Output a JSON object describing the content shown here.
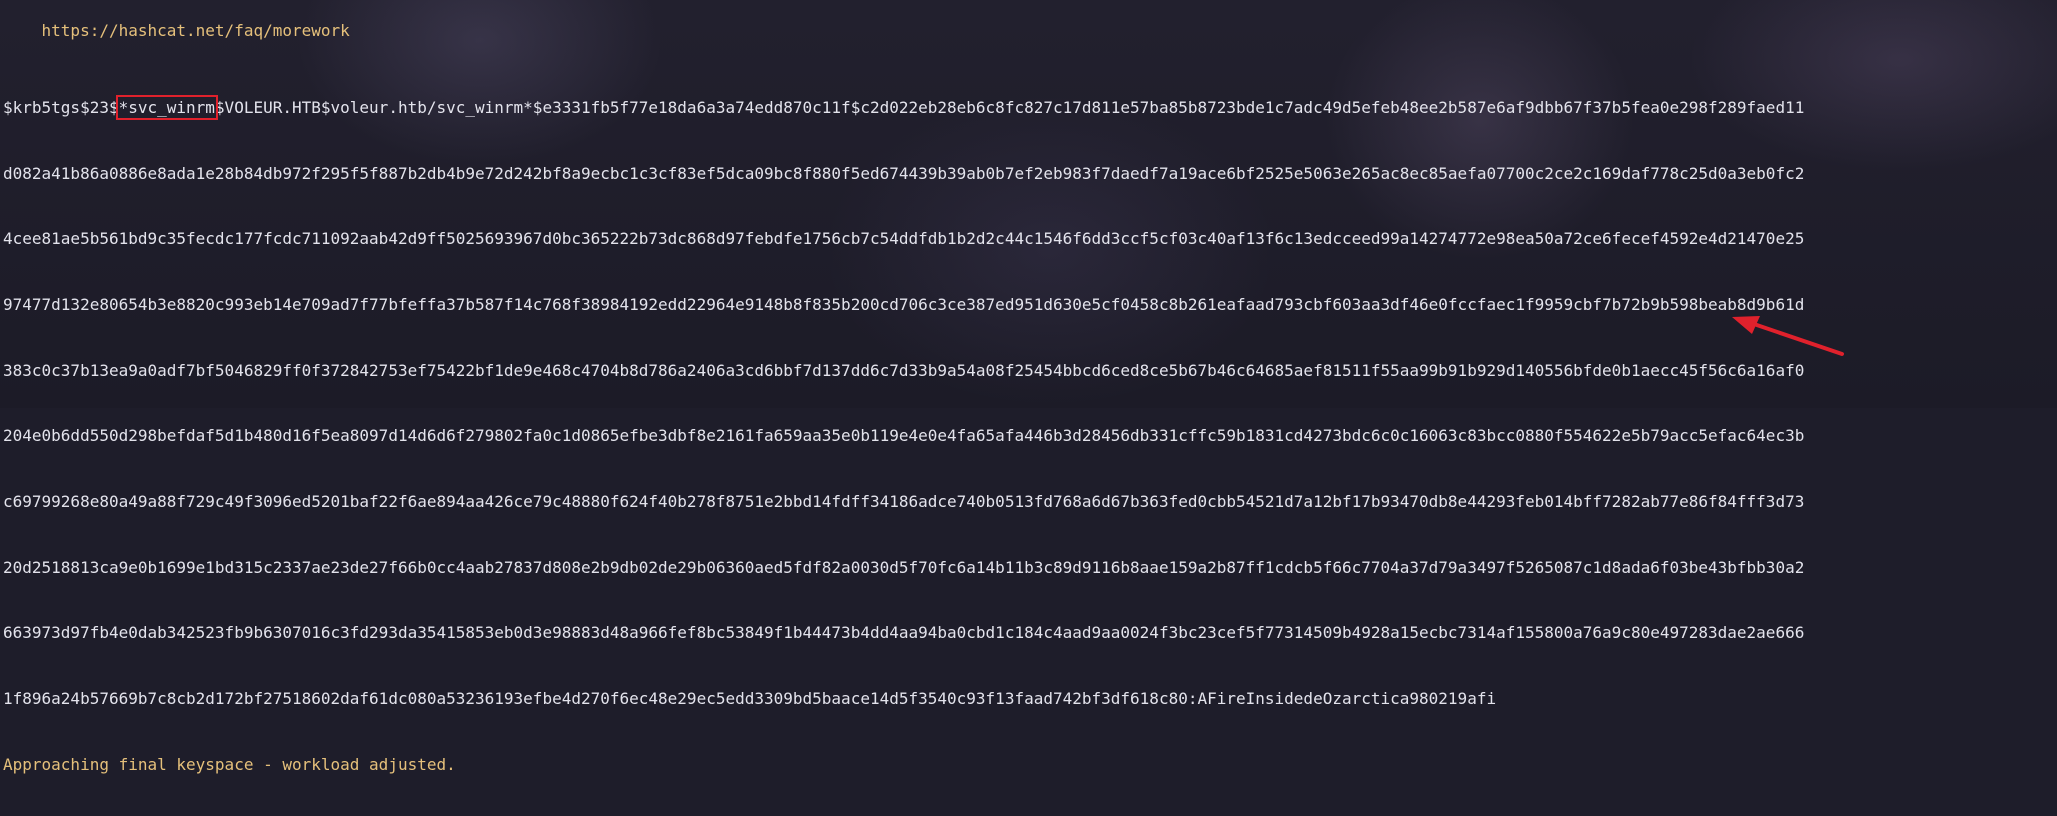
{
  "terminal": {
    "faq_url": "https://hashcat.net/faq/morework",
    "hash_prefix": "$krb5tgs$23$",
    "highlighted_user": "*svc_winrm",
    "hash_after_user": "$VOLEUR.HTB$voleur.htb/svc_winrm*$e3331fb5f77e18da6a3a74edd870c11f$c2d022eb28eb6c8fc827c17d811e57ba85b8723bde1c7adc49d5efeb48ee2b587e6af9dbb67f37b5fea0e298f289faed11",
    "hash_lines": [
      "d082a41b86a0886e8ada1e28b84db972f295f5f887b2db4b9e72d242bf8a9ecbc1c3cf83ef5dca09bc8f880f5ed674439b39ab0b7ef2eb983f7daedf7a19ace6bf2525e5063e265ac8ec85aefa07700c2ce2c169daf778c25d0a3eb0fc2",
      "4cee81ae5b561bd9c35fecdc177fcdc711092aab42d9ff5025693967d0bc365222b73dc868d97febdfe1756cb7c54ddfdb1b2d2c44c1546f6dd3ccf5cf03c40af13f6c13edcceed99a14274772e98ea50a72ce6fecef4592e4d21470e25",
      "97477d132e80654b3e8820c993eb14e709ad7f77bfeffa37b587f14c768f38984192edd22964e9148b8f835b200cd706c3ce387ed951d630e5cf0458c8b261eafaad793cbf603aa3df46e0fccfaec1f9959cbf7b72b9b598beab8d9b61d",
      "383c0c37b13ea9a0adf7bf5046829ff0f372842753ef75422bf1de9e468c4704b8d786a2406a3cd6bbf7d137dd6c7d33b9a54a08f25454bbcd6ced8ce5b67b46c64685aef81511f55aa99b91b929d140556bfde0b1aecc45f56c6a16af0",
      "204e0b6dd550d298befdaf5d1b480d16f5ea8097d14d6d6f279802fa0c1d0865efbe3dbf8e2161fa659aa35e0b119e4e0e4fa65afa446b3d28456db331cffc59b1831cd4273bdc6c0c16063c83bcc0880f554622e5b79acc5efac64ec3b",
      "c69799268e80a49a88f729c49f3096ed5201baf22f6ae894aa426ce79c48880f624f40b278f8751e2bbd14fdff34186adce740b0513fd768a6d67b363fed0cbb54521d7a12bf17b93470db8e44293feb014bff7282ab77e86f84fff3d73",
      "20d2518813ca9e0b1699e1bd315c2337ae23de27f66b0cc4aab27837d808e2b9db02de29b06360aed5fdf82a0030d5f70fc6a14b11b3c89d9116b8aae159a2b87ff1cdcb5f66c7704a37d79a3497f5265087c1d8ada6f03be43bfbb30a2",
      "663973d97fb4e0dab342523fb9b6307016c3fd293da35415853eb0d3e98883d48a966fef8bc53849f1b44473b4dd4aa94ba0cbd1c184c4aad9aa0024f3bc23cef5f77314509b4928a15ecbc7314af155800a76a9c80e497283dae2ae666"
    ],
    "last_line": "1f896a24b57669b7c8cb2d172bf27518602daf61dc080a53236193efbe4d270f6ec48e29ec5edd3309bd5baace14d5f3540c93f13faad742bf3df618c80:AFireInsidedeOzarctica980219afi",
    "status_message": "Approaching final keyspace - workload adjusted."
  },
  "colors": {
    "background": "#1e1d2a",
    "text": "#e3e3ec",
    "yellow_message": "#e5c07b",
    "annotation_red": "#e0212c"
  },
  "annotation": {
    "arrow_icon": "red-arrow-icon"
  }
}
